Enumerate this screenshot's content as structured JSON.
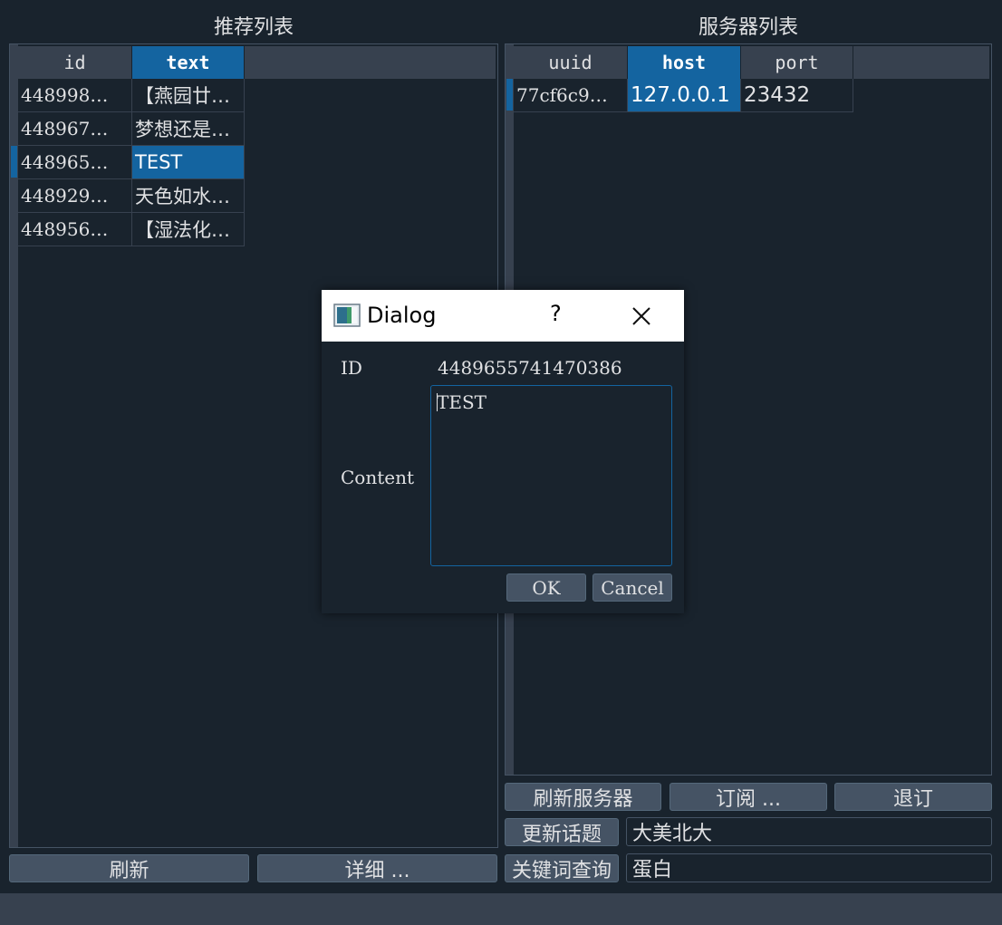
{
  "left_panel": {
    "title": "推荐列表",
    "columns": [
      "id",
      "text"
    ],
    "rows": [
      {
        "id": "448998…",
        "text": "【燕园廿…"
      },
      {
        "id": "448967…",
        "text": "梦想还是…"
      },
      {
        "id": "448965…",
        "text": "TEST"
      },
      {
        "id": "448929…",
        "text": "天色如水…"
      },
      {
        "id": "448956…",
        "text": "【湿法化…"
      }
    ],
    "refresh_label": "刷新",
    "detail_label": "详细 ..."
  },
  "right_panel": {
    "title": "服务器列表",
    "columns": [
      "uuid",
      "host",
      "port"
    ],
    "rows": [
      {
        "uuid": "77cf6c9…",
        "host": "127.0.0.1",
        "port": "23432"
      }
    ],
    "refresh_servers_label": "刷新服务器",
    "subscribe_label": "订阅 ...",
    "unsubscribe_label": "退订",
    "update_topic_label": "更新话题",
    "topic_value": "大美北大",
    "keyword_query_label": "关键词查询",
    "keyword_value": "蛋白"
  },
  "dialog": {
    "title": "Dialog",
    "help": "?",
    "id_label": "ID",
    "id_value": "4489655741470386",
    "content_label": "Content",
    "content_value": "TEST",
    "ok_label": "OK",
    "cancel_label": "Cancel"
  },
  "colors": {
    "background": "#19232d",
    "header": "#37414f",
    "selection": "#1464a0",
    "button": "#455364"
  }
}
